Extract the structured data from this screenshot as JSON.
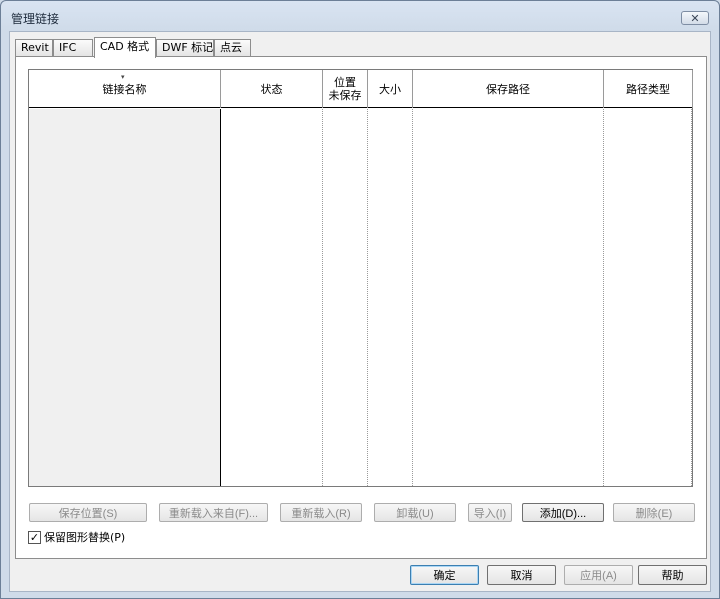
{
  "window": {
    "title": "管理链接",
    "close_symbol": "✕"
  },
  "tabs": [
    {
      "label": "Revit",
      "active": false
    },
    {
      "label": "IFC",
      "active": false
    },
    {
      "label": "CAD 格式",
      "active": true
    },
    {
      "label": "DWF 标记",
      "active": false
    },
    {
      "label": "点云",
      "active": false
    }
  ],
  "table": {
    "sort_indicator": "▾",
    "columns": [
      {
        "line1": "链接名称",
        "line2": ""
      },
      {
        "line1": "状态",
        "line2": ""
      },
      {
        "line1": "位置",
        "line2": "未保存"
      },
      {
        "line1": "大小",
        "line2": ""
      },
      {
        "line1": "保存路径",
        "line2": ""
      },
      {
        "line1": "路径类型",
        "line2": ""
      }
    ],
    "rows": []
  },
  "actions": {
    "save_location": "保存位置(S)",
    "reload_from": "重新载入来自(F)...",
    "reload": "重新载入(R)",
    "unload": "卸载(U)",
    "import": "导入(I)",
    "add": "添加(D)...",
    "remove": "删除(E)"
  },
  "options": {
    "keep_graphic_overrides": {
      "label": "保留图形替换(P)",
      "checked": true,
      "check_symbol": "✓"
    }
  },
  "footer": {
    "ok": "确定",
    "cancel": "取消",
    "apply": "应用(A)",
    "help": "帮助"
  }
}
